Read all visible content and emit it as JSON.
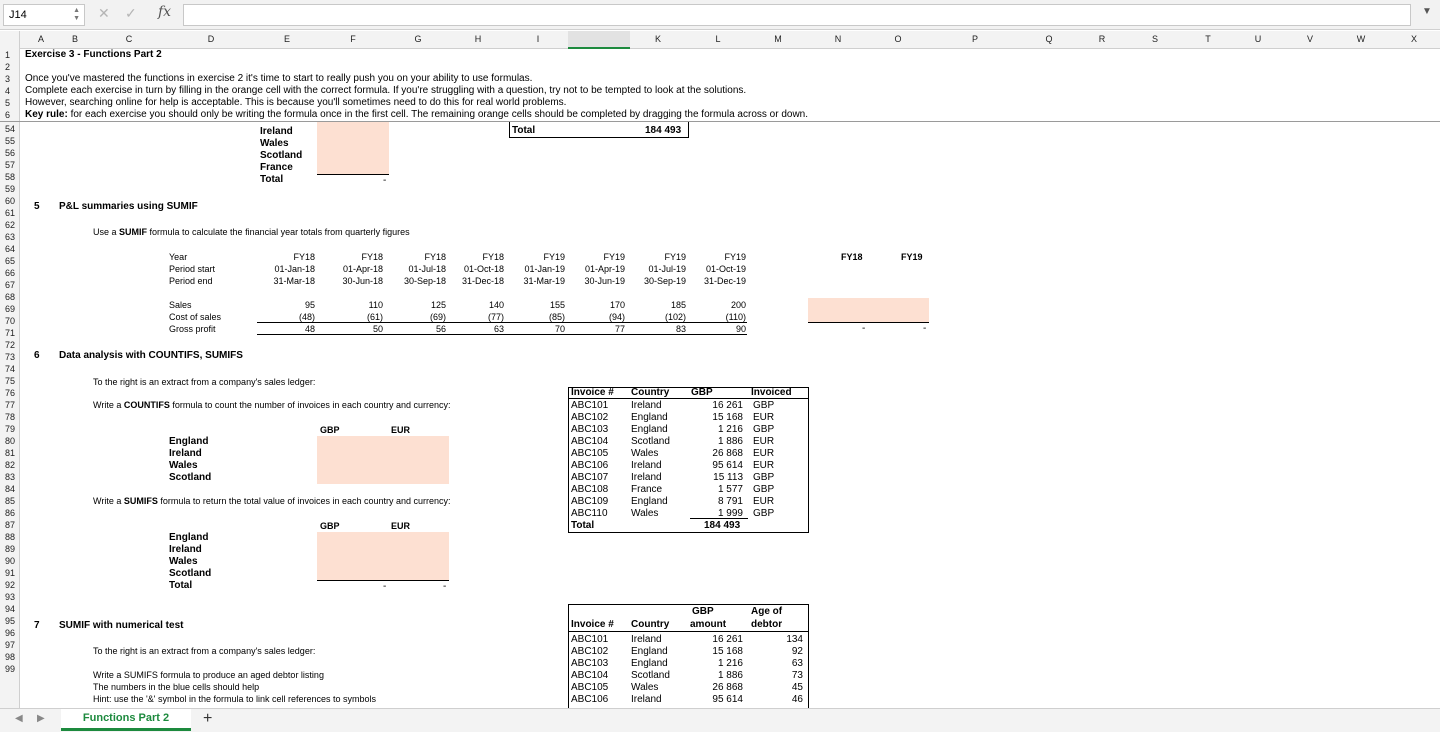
{
  "formula_bar": {
    "cell_ref": "J14",
    "fx": "fx",
    "formula": ""
  },
  "columns": [
    "A",
    "B",
    "C",
    "D",
    "E",
    "F",
    "G",
    "H",
    "I",
    "J",
    "K",
    "L",
    "M",
    "N",
    "O",
    "P",
    "Q",
    "R",
    "S",
    "T",
    "U",
    "V",
    "W",
    "X"
  ],
  "rows": [
    "1",
    "2",
    "3",
    "4",
    "5",
    "6",
    "54",
    "55",
    "56",
    "57",
    "58",
    "59",
    "60",
    "61",
    "62",
    "63",
    "64",
    "65",
    "66",
    "67",
    "68",
    "69",
    "70",
    "71",
    "72",
    "73",
    "74",
    "75",
    "76",
    "77",
    "78",
    "79",
    "80",
    "81",
    "82",
    "83",
    "84",
    "85",
    "86",
    "87",
    "88",
    "89",
    "90",
    "91",
    "92",
    "93",
    "94",
    "95",
    "96",
    "97",
    "98",
    "99"
  ],
  "header": {
    "title": "Exercise 3 - Functions Part 2",
    "line1": "Once you've mastered the functions in exercise 2 it's time to start to really push you on your ability to use formulas.",
    "line2": "Complete each exercise in turn by filling in the orange cell with the correct formula. If you're struggling with a question, try not to be tempted to look at the solutions.",
    "line3": "However, searching online for help is acceptable. This is because you'll sometimes need to do this for real world problems.",
    "key_label": "Key rule:",
    "key_text": " for each exercise you should only be writing the formula once in the first cell. The remaining orange cells should be completed by dragging the formula across or down."
  },
  "block4": {
    "countries": [
      "Ireland",
      "Wales",
      "Scotland",
      "France",
      "Total"
    ],
    "total_dash": "-",
    "right_total_label": "Total",
    "right_total_value": "184 493"
  },
  "section5": {
    "num": "5",
    "title": "P&L summaries using SUMIF",
    "intro_pre": "Use a ",
    "intro_fn": "SUMIF",
    "intro_post": " formula to calculate the financial year totals from quarterly figures",
    "row_labels": [
      "Year",
      "Period start",
      "Period end",
      "Sales",
      "Cost of sales",
      "Gross profit"
    ],
    "years": [
      "FY18",
      "FY18",
      "FY18",
      "FY18",
      "FY19",
      "FY19",
      "FY19",
      "FY19"
    ],
    "starts": [
      "01-Jan-18",
      "01-Apr-18",
      "01-Jul-18",
      "01-Oct-18",
      "01-Jan-19",
      "01-Apr-19",
      "01-Jul-19",
      "01-Oct-19"
    ],
    "ends": [
      "31-Mar-18",
      "30-Jun-18",
      "30-Sep-18",
      "31-Dec-18",
      "31-Mar-19",
      "30-Jun-19",
      "30-Sep-19",
      "31-Dec-19"
    ],
    "sales": [
      "95",
      "110",
      "125",
      "140",
      "155",
      "170",
      "185",
      "200"
    ],
    "cost": [
      "(48)",
      "(61)",
      "(69)",
      "(77)",
      "(85)",
      "(94)",
      "(102)",
      "(110)"
    ],
    "gross": [
      "48",
      "50",
      "56",
      "63",
      "70",
      "77",
      "83",
      "90"
    ],
    "summary_heads": [
      "FY18",
      "FY19"
    ],
    "summary_dash": "-"
  },
  "section6": {
    "num": "6",
    "title": "Data analysis with COUNTIFS, SUMIFS",
    "intro": "To the right is an extract from a company's sales ledger:",
    "countifs_pre": "Write a ",
    "countifs_fn": "COUNTIFS",
    "countifs_post": " formula to count the number of invoices in each country and currency:",
    "sumifs_pre": "Write a ",
    "sumifs_fn": "SUMIFS",
    "sumifs_post": " formula to return the total value of invoices in each country and currency:",
    "cur_heads": [
      "GBP",
      "EUR"
    ],
    "countries1": [
      "England",
      "Ireland",
      "Wales",
      "Scotland"
    ],
    "countries2": [
      "England",
      "Ireland",
      "Wales",
      "Scotland",
      "Total"
    ],
    "dash": "-",
    "ledger_heads": [
      "Invoice #",
      "Country",
      "GBP",
      "Invoiced"
    ],
    "ledger": [
      [
        "ABC101",
        "Ireland",
        "16 261",
        "GBP"
      ],
      [
        "ABC102",
        "England",
        "15 168",
        "EUR"
      ],
      [
        "ABC103",
        "England",
        "1 216",
        "GBP"
      ],
      [
        "ABC104",
        "Scotland",
        "1 886",
        "EUR"
      ],
      [
        "ABC105",
        "Wales",
        "26 868",
        "EUR"
      ],
      [
        "ABC106",
        "Ireland",
        "95 614",
        "EUR"
      ],
      [
        "ABC107",
        "Ireland",
        "15 113",
        "GBP"
      ],
      [
        "ABC108",
        "France",
        "1 577",
        "GBP"
      ],
      [
        "ABC109",
        "England",
        "8 791",
        "EUR"
      ],
      [
        "ABC110",
        "Wales",
        "1 999",
        "GBP"
      ]
    ],
    "ledger_total_label": "Total",
    "ledger_total": "184 493"
  },
  "section7": {
    "num": "7",
    "title": "SUMIF with numerical test",
    "intro": "To the right is an extract from a company's sales ledger:",
    "l1": "Write a SUMIFS formula to produce an aged debtor listing",
    "l2": "The numbers in the blue cells should help",
    "l3": "Hint: use the '&' symbol in the formula to link cell references to symbols",
    "head_invoice": "Invoice #",
    "head_country": "Country",
    "head_gbp_top": "GBP",
    "head_gbp_bottom": "amount",
    "head_age_top": "Age of",
    "head_age_bottom": "debtor",
    "ledger": [
      [
        "ABC101",
        "Ireland",
        "16 261",
        "134"
      ],
      [
        "ABC102",
        "England",
        "15 168",
        "92"
      ],
      [
        "ABC103",
        "England",
        "1 216",
        "63"
      ],
      [
        "ABC104",
        "Scotland",
        "1 886",
        "73"
      ],
      [
        "ABC105",
        "Wales",
        "26 868",
        "45"
      ],
      [
        "ABC106",
        "Ireland",
        "95 614",
        "46"
      ]
    ]
  },
  "tabs": {
    "active": "Functions Part 2",
    "add": "+"
  },
  "colors": {
    "accent": "#1d8a3e",
    "input_cell": "#fde0d2"
  }
}
